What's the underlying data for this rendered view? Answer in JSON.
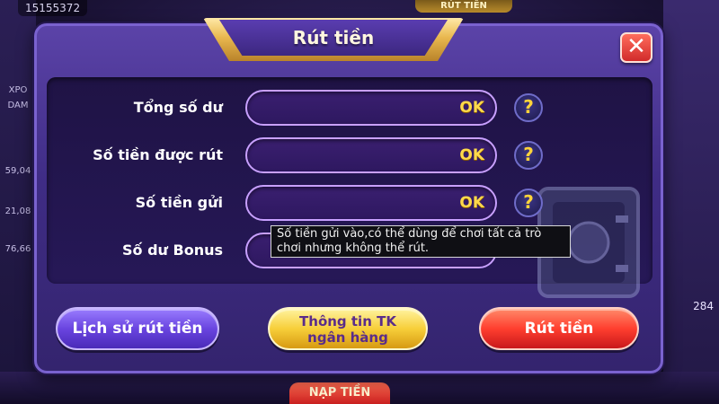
{
  "background": {
    "balance_top": "15155372",
    "top_tab": "RÚT TIỀN",
    "side_items": [
      "XPO",
      "DAM",
      "59,04",
      "21,08",
      "76,66"
    ],
    "right_number": "284",
    "bottom_tab": "NẠP TIỀN"
  },
  "dialog": {
    "title": "Rút tiền",
    "close_symbol": "✕",
    "rows": [
      {
        "label": "Tổng số dư",
        "value": "OK"
      },
      {
        "label": "Số tiền được rút",
        "value": "OK"
      },
      {
        "label": "Số tiền gửi",
        "value": "OK"
      },
      {
        "label": "Số dư Bonus",
        "value": ""
      }
    ],
    "help_symbol": "?",
    "tooltip": "Số tiền gửi vào,có thể dùng để chơi tất cả trò chơi nhưng không thể rút.",
    "buttons": {
      "history": "Lịch sử rút tiền",
      "bank_line1": "Thông tin TK",
      "bank_line2": "ngân hàng",
      "withdraw": "Rút tiền"
    }
  },
  "colors": {
    "accent_gold": "#ffd94a",
    "dialog_purple": "#3f2c85",
    "close_red": "#d12b2b"
  }
}
